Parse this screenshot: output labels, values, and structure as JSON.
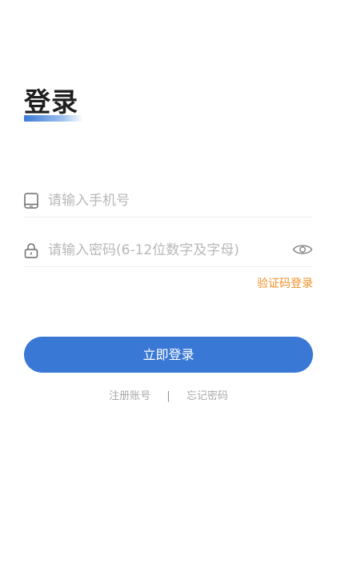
{
  "header": {
    "title": "登录"
  },
  "form": {
    "phone_placeholder": "请输入手机号",
    "password_placeholder": "请输入密码(6-12位数字及字母)",
    "sms_login_label": "验证码登录"
  },
  "actions": {
    "login_label": "立即登录",
    "register_label": "注册账号",
    "separator": "|",
    "forgot_label": "忘记密码"
  },
  "icons": {
    "phone": "phone-icon",
    "lock": "lock-icon",
    "eye": "eye-icon"
  },
  "colors": {
    "primary": "#3a78d6",
    "accent": "#f0912a",
    "placeholder": "#b8b8b8",
    "title": "#1f1f1f"
  }
}
